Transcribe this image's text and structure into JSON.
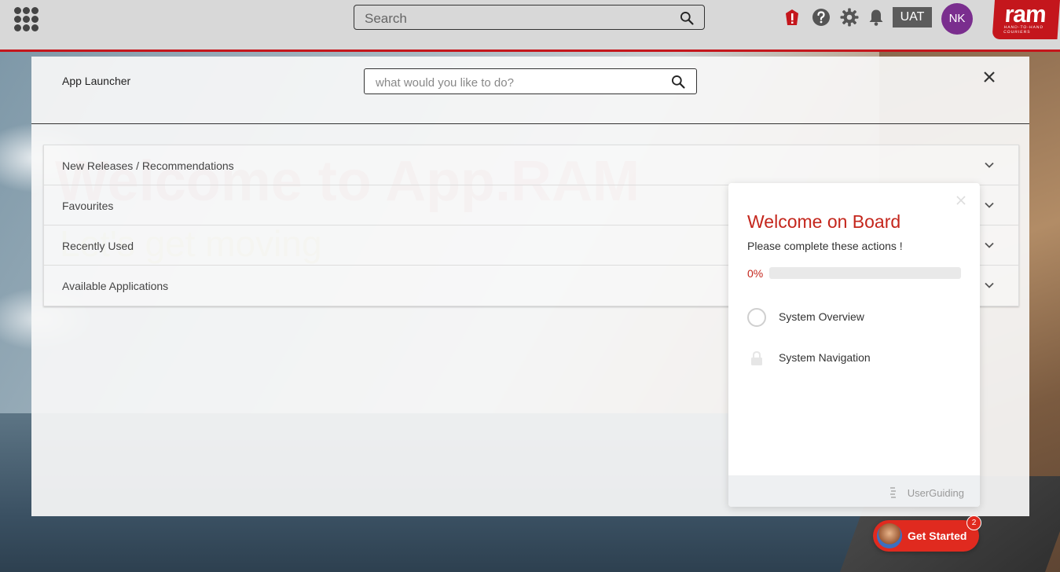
{
  "topbar": {
    "search_placeholder": "Search",
    "env_badge": "UAT",
    "avatar_initials": "NK",
    "logo_text": "ram",
    "logo_tagline": "HAND-TO-HAND COURIERS",
    "accent_color": "#c4161c",
    "icons": [
      "apps-grid-icon",
      "search-icon",
      "gift-icon",
      "help-icon",
      "gear-icon",
      "bell-icon"
    ]
  },
  "launcher": {
    "title": "App Launcher",
    "search_placeholder": "what would you like to do?",
    "background_heading": "Welcome to App.RAM",
    "background_subheading": "Let's get moving",
    "sections": [
      {
        "label": "New Releases / Recommendations"
      },
      {
        "label": "Favourites"
      },
      {
        "label": "Recently Used"
      },
      {
        "label": "Available Applications"
      }
    ]
  },
  "onboarding": {
    "heading": "Welcome on Board",
    "subheading": "Please complete these actions !",
    "progress_label": "0%",
    "progress_value": 0,
    "steps": [
      {
        "label": "System Overview",
        "state": "open"
      },
      {
        "label": "System Navigation",
        "state": "locked"
      }
    ],
    "footer_brand": "UserGuiding"
  },
  "get_started": {
    "label": "Get Started",
    "badge_count": "2"
  }
}
